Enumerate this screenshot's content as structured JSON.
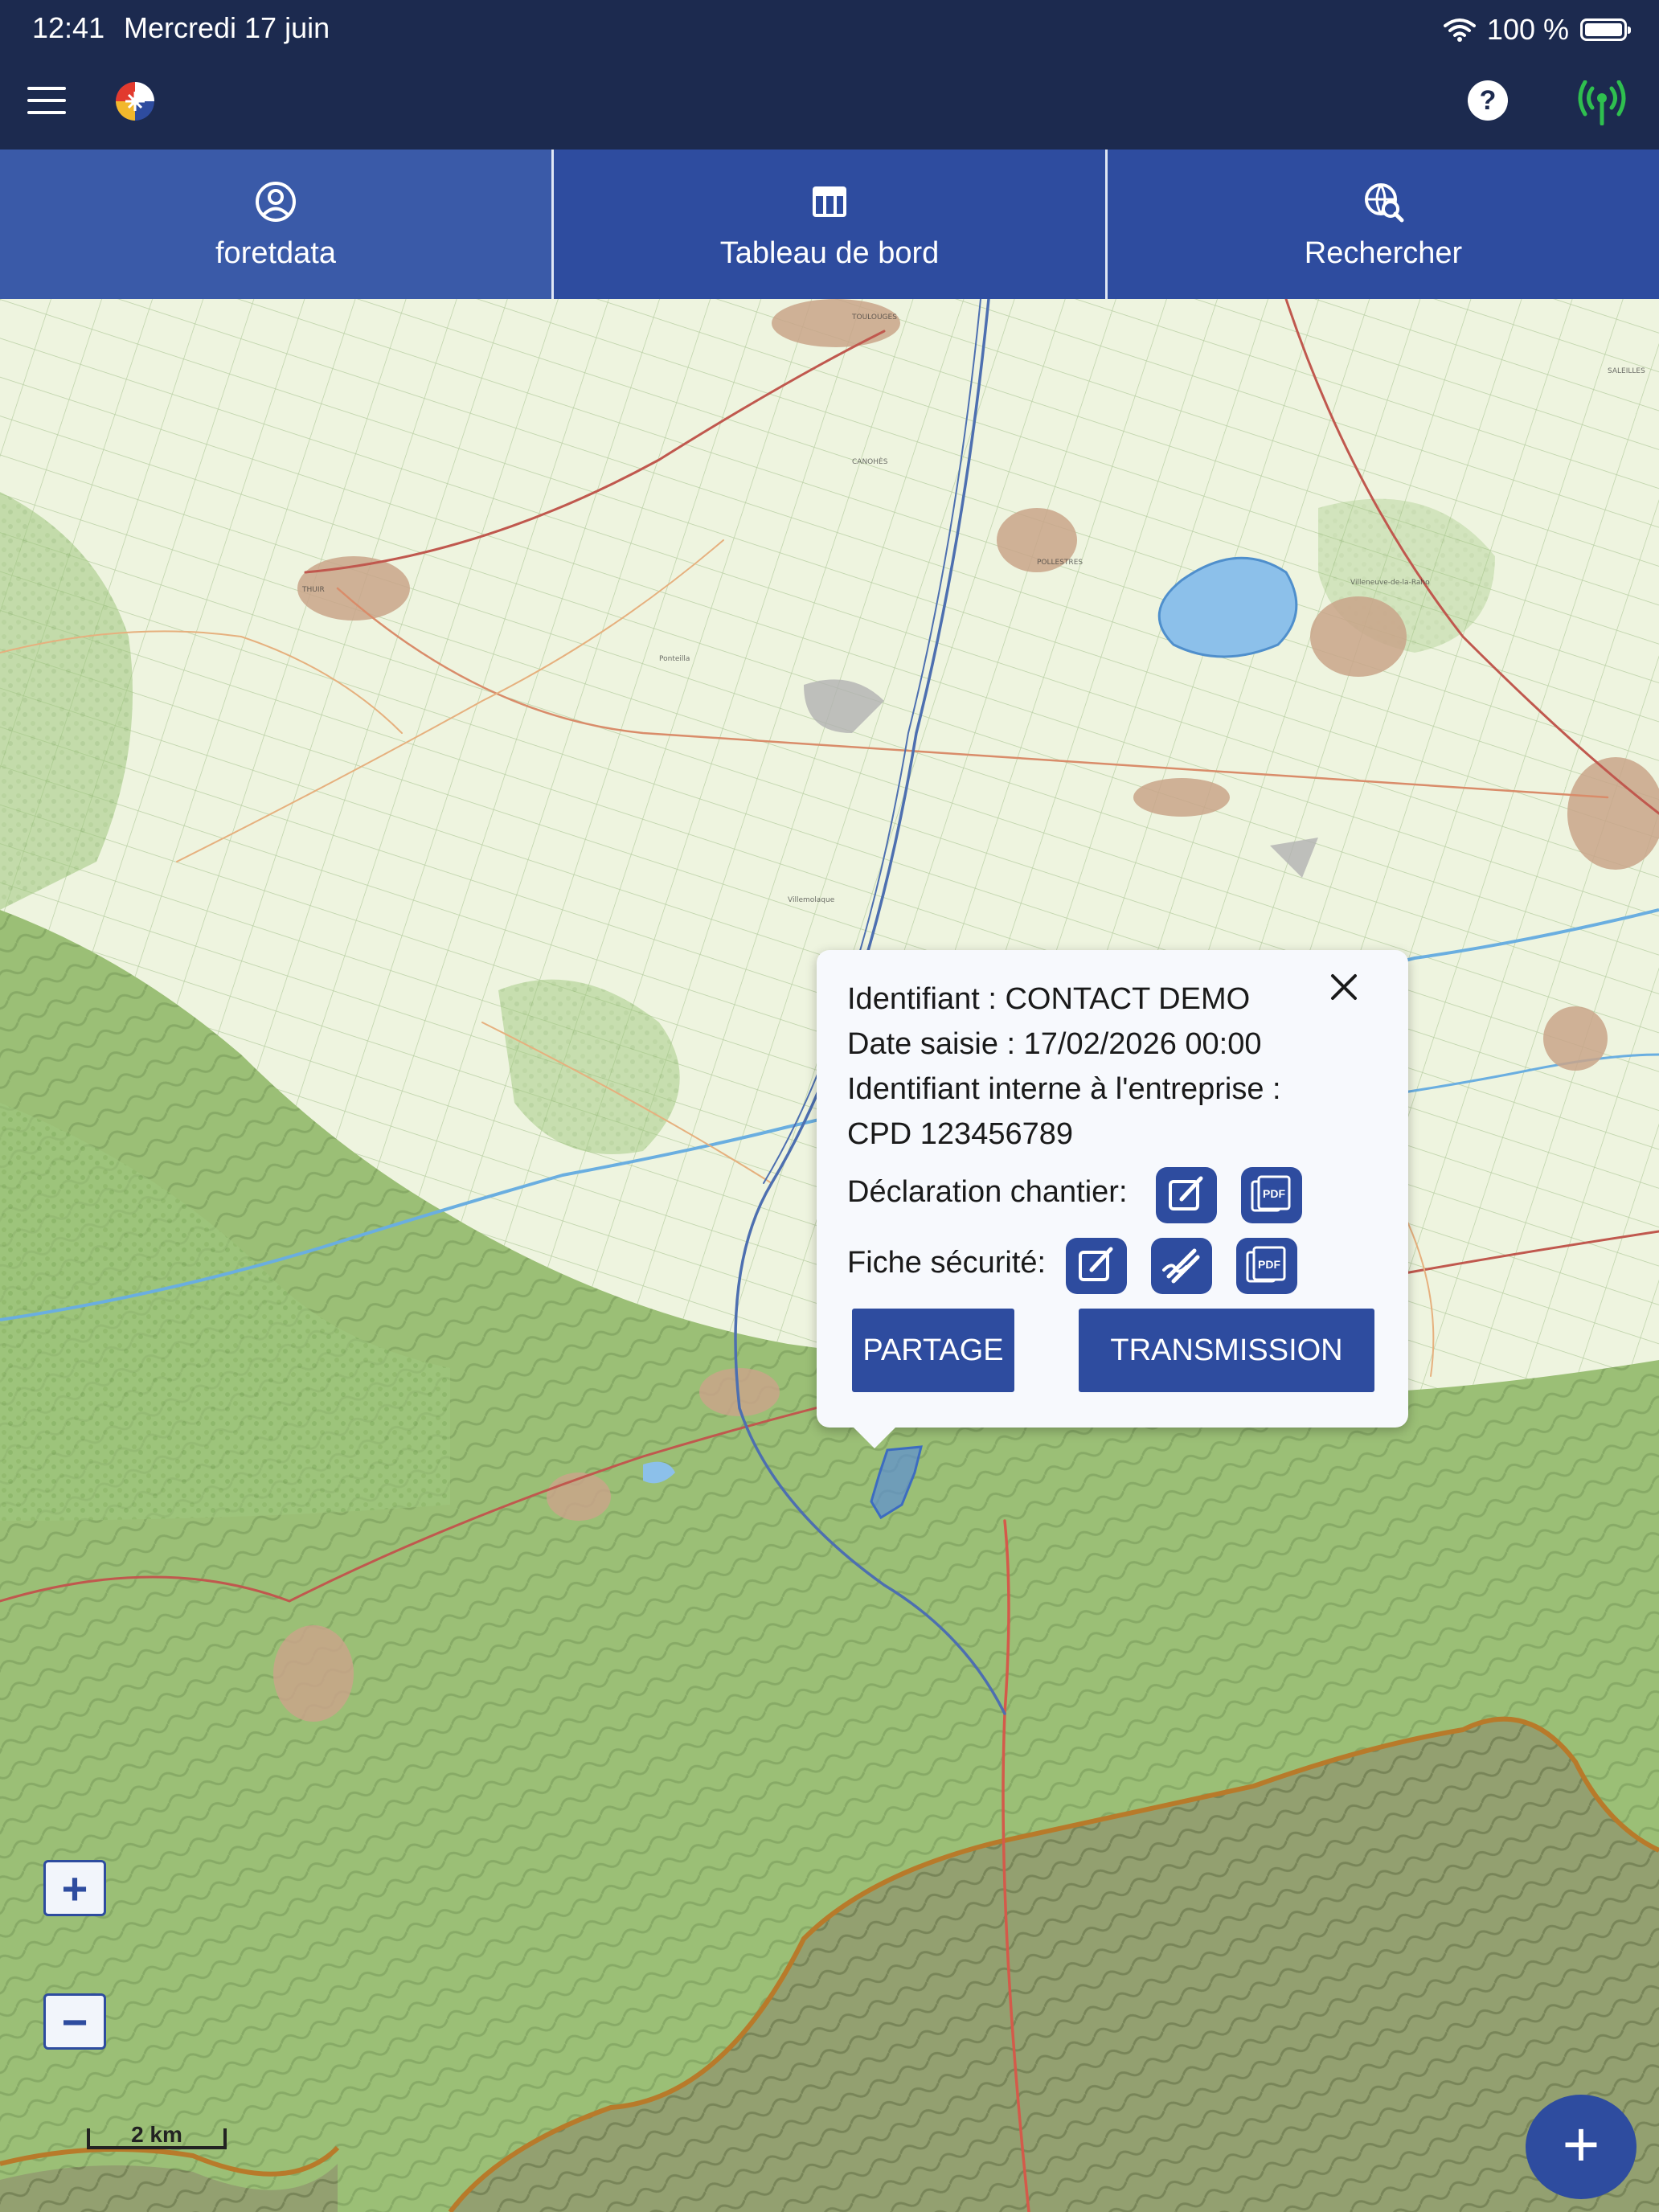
{
  "status_bar": {
    "time": "12:41",
    "date": "Mercredi 17 juin",
    "battery": "100 %",
    "wifi_icon": "wifi-icon",
    "battery_icon": "battery-icon"
  },
  "app_bar": {
    "menu_icon": "hamburger-menu-icon",
    "logo_icon": "app-logo",
    "help_label": "?",
    "signal_icon": "broadcast-signal-icon",
    "signal_color": "#2fbf4f"
  },
  "tabs": [
    {
      "label": "foretdata",
      "icon": "user-circle-icon"
    },
    {
      "label": "Tableau de bord",
      "icon": "table-icon"
    },
    {
      "label": "Rechercher",
      "icon": "search-globe-icon"
    }
  ],
  "popup": {
    "identifiant": "Identifiant : CONTACT DEMO",
    "date_saisie": "Date saisie : 17/02/2026 00:00",
    "identifiant_interne_label": "Identifiant interne à l'entreprise :",
    "identifiant_interne_value": "CPD 123456789",
    "declaration_label": "Déclaration chantier:",
    "fiche_label": "Fiche sécurité:",
    "pdf_text": "PDF",
    "partage_label": "PARTAGE",
    "transmission_label": "TRANSMISSION"
  },
  "map": {
    "zoom_in_label": "+",
    "zoom_out_label": "−",
    "scale_label": "2 km",
    "add_label": "+"
  },
  "colors": {
    "header": "#1c2a4f",
    "primary": "#2e4c9f",
    "tab_active": "#3a5aa8",
    "map_plain": "#eef4e1",
    "map_forest": "#9bc27a"
  }
}
